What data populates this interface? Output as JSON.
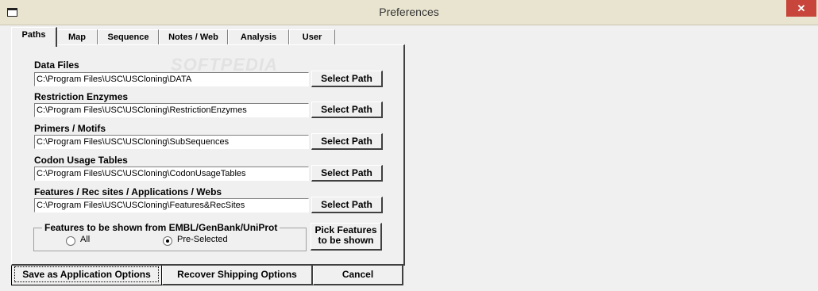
{
  "window": {
    "title": "Preferences",
    "close_label": "✕"
  },
  "tabs": [
    {
      "label": "Paths"
    },
    {
      "label": "Map"
    },
    {
      "label": "Sequence"
    },
    {
      "label": "Notes / Web"
    },
    {
      "label": "Analysis"
    },
    {
      "label": "User"
    }
  ],
  "paths": [
    {
      "label": "Data Files",
      "value": "C:\\Program Files\\USC\\USCloning\\DATA",
      "button": "Select Path"
    },
    {
      "label": "Restriction Enzymes",
      "value": "C:\\Program Files\\USC\\USCloning\\RestrictionEnzymes",
      "button": "Select Path"
    },
    {
      "label": "Primers / Motifs",
      "value": "C:\\Program Files\\USC\\USCloning\\SubSequences",
      "button": "Select Path"
    },
    {
      "label": "Codon Usage Tables",
      "value": "C:\\Program Files\\USC\\USCloning\\CodonUsageTables",
      "button": "Select Path"
    },
    {
      "label": "Features / Rec sites / Applications / Webs",
      "value": "C:\\Program Files\\USC\\USCloning\\Features&RecSites",
      "button": "Select Path"
    }
  ],
  "features": {
    "group_label": "Features to be shown from EMBL/GenBank/UniProt",
    "option_all": "All",
    "option_preselected": "Pre-Selected",
    "selected": "Pre-Selected",
    "pick_line1": "Pick Features",
    "pick_line2": "to be shown"
  },
  "buttons": {
    "save": "Save as Application Options",
    "recover": "Recover Shipping Options",
    "cancel": "Cancel"
  },
  "watermark": "SOFTPEDIA"
}
